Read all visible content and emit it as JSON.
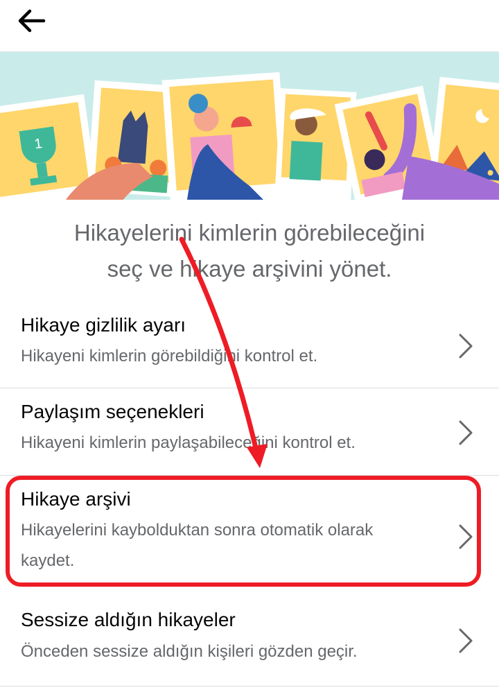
{
  "header": {
    "back_icon": "arrow-left-icon"
  },
  "banner": {
    "illustration": "story-photos-illustration",
    "trophy_number": "1"
  },
  "intro_text": {
    "line1": "Hikayelerini kimlerin görebileceğini",
    "line2": "seç ve hikaye arşivini yönet."
  },
  "settings": [
    {
      "title": "Hikaye gizlilik ayarı",
      "subtitle": "Hikayeni kimlerin görebildiğini kontrol et.",
      "icon": "chevron-right-icon"
    },
    {
      "title": "Paylaşım seçenekleri",
      "subtitle": "Hikayeni kimlerin paylaşabileceğini kontrol et.",
      "icon": "chevron-right-icon"
    },
    {
      "title": "Hikaye arşivi",
      "subtitle_line1": "Hikayelerini kaybolduktan sonra otomatik olarak",
      "subtitle_line2": "kaydet.",
      "icon": "chevron-right-icon"
    },
    {
      "title": "Sessize aldığın hikayeler",
      "subtitle": "Önceden sessize aldığın kişileri gözden geçir.",
      "icon": "chevron-right-icon"
    }
  ],
  "annotation": {
    "color": "#ee1c25",
    "arrow": "red-arrow-annotation",
    "highlight": "red-highlight-box"
  }
}
